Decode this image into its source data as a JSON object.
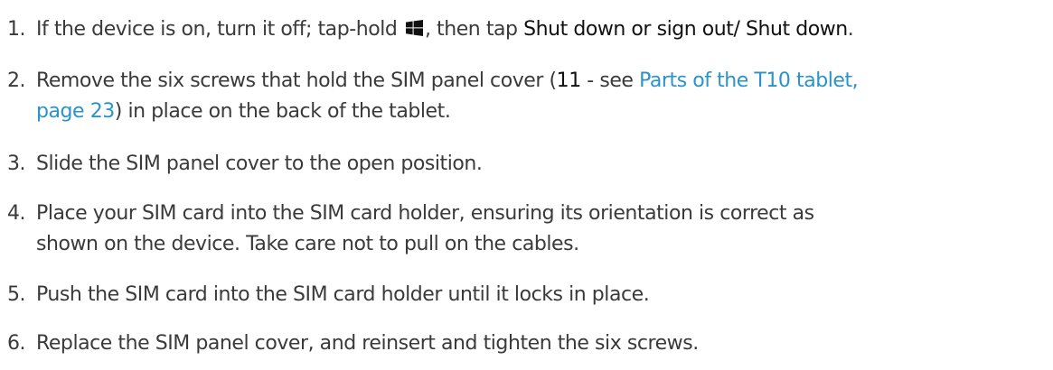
{
  "steps": [
    {
      "number": "1.",
      "lead": "If the device is on, turn it off; tap-hold",
      "icon": "windows-logo-icon",
      "mid": ", then tap ",
      "action1": "Shut down or sign out",
      "sep": "/ ",
      "action2": "Shut down",
      "end": "."
    },
    {
      "number": "2.",
      "lead": "Remove the six screws that hold the SIM panel cover (",
      "ref_number": "11",
      "ref_sep": " - see ",
      "link_line1": "Parts of the T10 tablet,",
      "link_line2": "page 23",
      "tail": ") in place on the back of the tablet."
    },
    {
      "number": "3.",
      "text": "Slide the SIM panel cover to the open position."
    },
    {
      "number": "4.",
      "line1": "Place your SIM card into the SIM card holder, ensuring its orientation is correct as",
      "line2": "shown on the device. Take care not to pull on the cables."
    },
    {
      "number": "5.",
      "text": "Push the SIM card into the SIM card holder until it locks in place."
    },
    {
      "number": "6.",
      "text": "Replace the SIM panel cover, and reinsert and tighten the six screws."
    }
  ]
}
